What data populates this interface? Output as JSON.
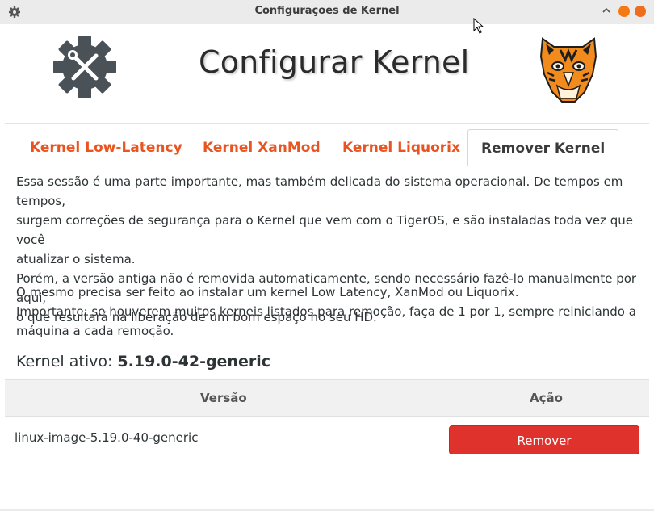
{
  "window": {
    "title": "Configurações de Kernel"
  },
  "header": {
    "title": "Configurar Kernel",
    "left_icon": "gear-wrench-icon",
    "right_icon": "tiger-logo"
  },
  "tabs": [
    {
      "label": "Kernel Low-Latency",
      "active": false
    },
    {
      "label": "Kernel XanMod",
      "active": false
    },
    {
      "label": "Kernel Liquorix",
      "active": false
    },
    {
      "label": "Remover Kernel",
      "active": true
    }
  ],
  "content": {
    "paragraph1": [
      "Essa sessão é uma parte importante, mas também delicada do sistema operacional. De tempos em tempos,",
      "surgem correções de segurança para o Kernel que vem com o TigerOS, e são instaladas toda vez que você",
      "atualizar o sistema.",
      "Porém, a versão antiga não é removida automaticamente, sendo necessário fazê-lo manualmente por aqui,",
      "o que resultará na liberação de um bom espaço no seu HD."
    ],
    "paragraph2": [
      "O mesmo precisa ser feito ao instalar um kernel Low Latency, XanMod ou Liquorix.",
      "Importante: se houverem muitos kerneis listados para remoção, faça de 1 por 1, sempre reiniciando a",
      "máquina a cada remoção."
    ],
    "active_kernel_label": "Kernel ativo: ",
    "active_kernel_value": "5.19.0-42-generic"
  },
  "table": {
    "headers": {
      "version": "Versão",
      "action": "Ação"
    },
    "rows": [
      {
        "version": "linux-image-5.19.0-40-generic",
        "action_label": "Remover"
      }
    ]
  },
  "colors": {
    "accent": "#e95420",
    "remove_button": "#e0322d"
  }
}
